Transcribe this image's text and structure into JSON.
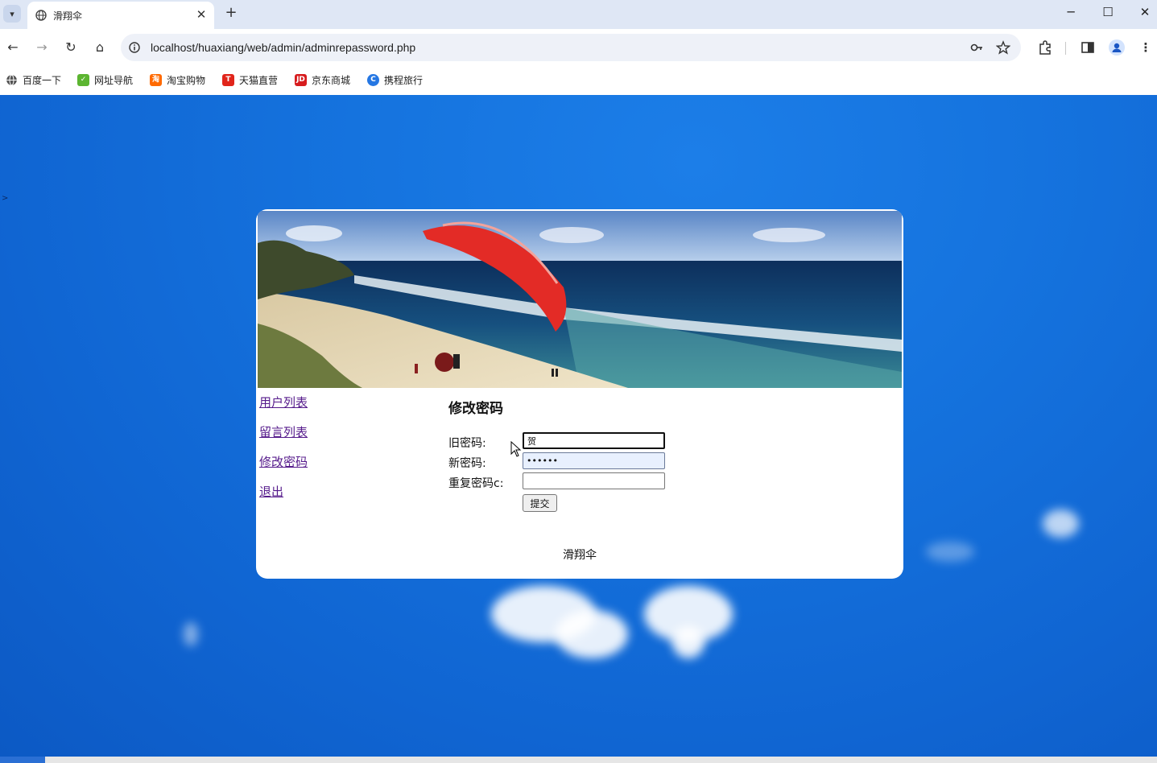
{
  "browser": {
    "tab": {
      "title": "滑翔伞",
      "close_symbol": "✕"
    },
    "new_tab_symbol": "+",
    "window_controls": {
      "minimize": "─",
      "maximize": "☐",
      "close": "✕"
    },
    "nav": {
      "back": "←",
      "forward": "→",
      "reload": "↻",
      "home": "⌂"
    },
    "url": "localhost/huaxiang/web/admin/adminrepassword.php",
    "bookmarks": [
      {
        "label": "百度一下",
        "icon": "globe-icon",
        "color": "#555555"
      },
      {
        "label": "网址导航",
        "icon": "hao123-icon",
        "color": "#5cb531"
      },
      {
        "label": "淘宝购物",
        "icon": "taobao-icon",
        "color": "#ff6a00"
      },
      {
        "label": "天猫直营",
        "icon": "tmall-icon",
        "color": "#e1251b"
      },
      {
        "label": "京东商城",
        "icon": "jd-icon",
        "color": "#d71c1e"
      },
      {
        "label": "携程旅行",
        "icon": "ctrip-icon",
        "color": "#2577e3"
      }
    ]
  },
  "page": {
    "stray_char": ">",
    "sidebar": {
      "links": [
        {
          "label": "用户列表"
        },
        {
          "label": "留言列表"
        },
        {
          "label": "修改密码"
        },
        {
          "label": "退出"
        }
      ]
    },
    "form": {
      "title": "修改密码",
      "old_password_label": "旧密码:",
      "old_password_value": "贺",
      "new_password_label": "新密码:",
      "new_password_value": "••••••",
      "repeat_password_label": "重复密码c:",
      "repeat_password_value": "",
      "submit_label": "提交"
    },
    "footer": "滑翔伞"
  },
  "colors": {
    "page_bg": "#1573de",
    "link": "#551a8b",
    "autofill": "#e8f0fe"
  }
}
